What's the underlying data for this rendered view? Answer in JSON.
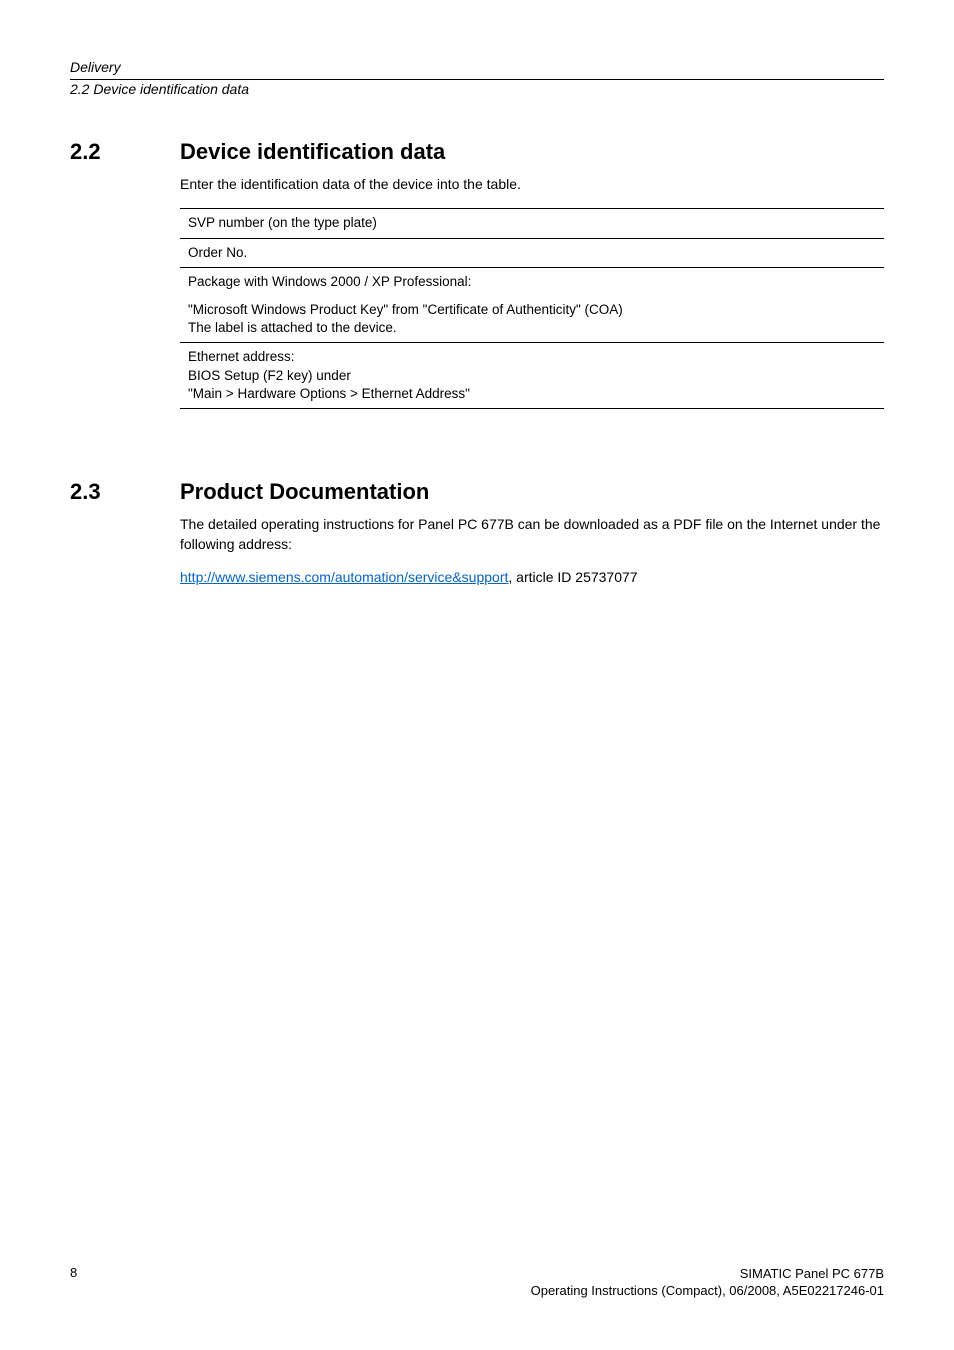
{
  "running_head": {
    "line1": "Delivery",
    "line2": "2.2 Device identification data"
  },
  "sections": [
    {
      "number": "2.2",
      "title": "Device identification data",
      "intro": "Enter the identification data of the device into the table.",
      "rows": [
        "SVP number (on the type plate)",
        "Order No.",
        "Package with Windows 2000 / XP Professional:",
        "\"Microsoft Windows Product Key\" from \"Certificate of Authenticity\" (COA)\nThe label is attached to the device.",
        "Ethernet address:\nBIOS Setup (F2 key) under\n\"Main > Hardware Options > Ethernet Address\""
      ]
    },
    {
      "number": "2.3",
      "title": "Product Documentation",
      "para1": "The detailed operating instructions for Panel PC 677B can be downloaded as a PDF file on the Internet under the following address:",
      "link_text": "http://www.siemens.com/automation/service&support",
      "para2_suffix": ", article ID 25737077"
    }
  ],
  "footer": {
    "page": "8",
    "right1": "SIMATIC Panel PC 677B",
    "right2": "Operating Instructions (Compact), 06/2008, A5E02217246-01"
  }
}
